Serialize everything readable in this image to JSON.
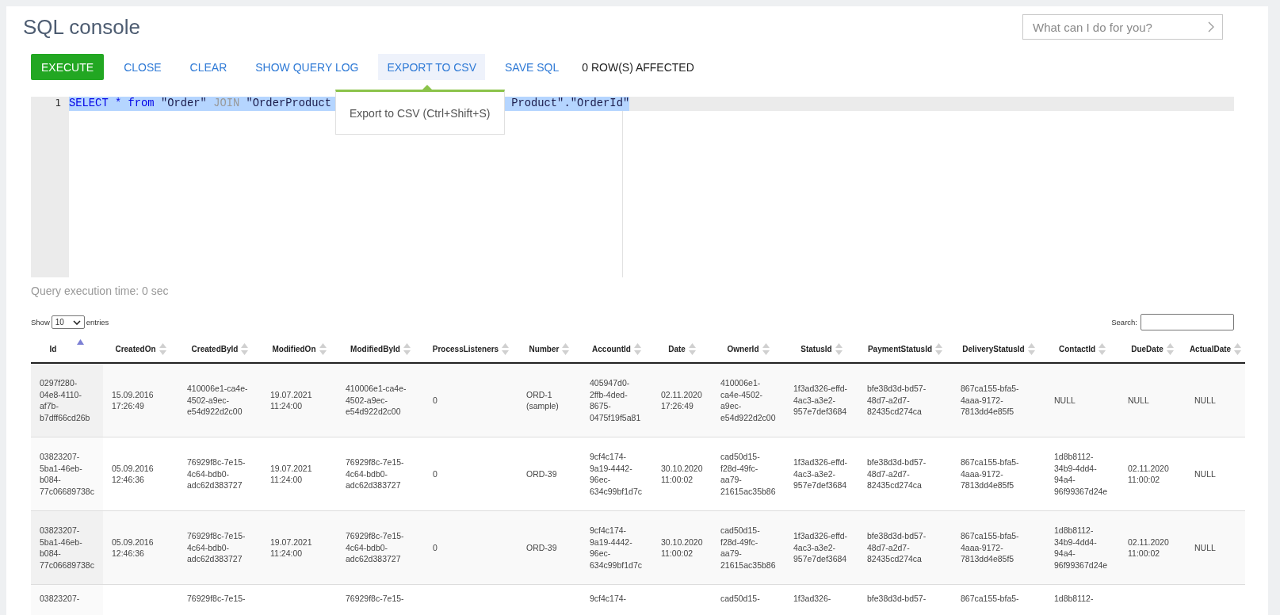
{
  "title": "SQL console",
  "assistant": {
    "placeholder": "What can I do for you?"
  },
  "toolbar": {
    "buttons": [
      {
        "label": "EXECUTE",
        "kind": "primary",
        "hovered": false
      },
      {
        "label": "CLOSE",
        "kind": "link",
        "hovered": false
      },
      {
        "label": "CLEAR",
        "kind": "link",
        "hovered": false
      },
      {
        "label": "SHOW QUERY LOG",
        "kind": "link",
        "hovered": false
      },
      {
        "label": "EXPORT TO CSV",
        "kind": "link",
        "hovered": true
      },
      {
        "label": "SAVE SQL",
        "kind": "link",
        "hovered": false
      }
    ],
    "status": "0 ROW(S) AFFECTED"
  },
  "editor": {
    "line_number": "1",
    "selected": true,
    "visible_parts": [
      [
        {
          "text": "SELECT",
          "kind": "keyword"
        },
        {
          "text": "*",
          "kind": "keyword"
        },
        {
          "text": "from",
          "kind": "keyword"
        },
        {
          "text": "\"Order\"",
          "kind": "string"
        },
        {
          "text": "JOIN",
          "kind": "muted"
        },
        {
          "text": "\"OrderProduct",
          "kind": "string"
        }
      ],
      [
        {
          "text": "Product\".\"OrderId\"",
          "kind": "string"
        }
      ]
    ]
  },
  "tooltip": {
    "text": "Export to CSV (Ctrl+Shift+S)"
  },
  "execution_time": "Query execution time: 0 sec",
  "table": {
    "show_label": "Show",
    "page_size": "10",
    "entries_label": "entries",
    "search_label": "Search:",
    "columns": [
      {
        "label": "Id",
        "sorted": true
      },
      {
        "label": "CreatedOn",
        "sorted": false
      },
      {
        "label": "CreatedById",
        "sorted": false
      },
      {
        "label": "ModifiedOn",
        "sorted": false
      },
      {
        "label": "ModifiedById",
        "sorted": false
      },
      {
        "label": "ProcessListeners",
        "sorted": false
      },
      {
        "label": "Number",
        "sorted": false
      },
      {
        "label": "AccountId",
        "sorted": false
      },
      {
        "label": "Date",
        "sorted": false
      },
      {
        "label": "OwnerId",
        "sorted": false
      },
      {
        "label": "StatusId",
        "sorted": false
      },
      {
        "label": "PaymentStatusId",
        "sorted": false
      },
      {
        "label": "DeliveryStatusId",
        "sorted": false
      },
      {
        "label": "ContactId",
        "sorted": false
      },
      {
        "label": "DueDate",
        "sorted": false
      },
      {
        "label": "ActualDate",
        "sorted": false
      }
    ],
    "rows": [
      {
        "cut": false,
        "cells": [
          "0297f280-04e8-4110-af7b-b7dff66cd26b",
          "15.09.2016 17:26:49",
          "410006e1-ca4e-4502-a9ec-e54d922d2c00",
          "19.07.2021 11:24:00",
          "410006e1-ca4e-4502-a9ec-e54d922d2c00",
          "0",
          "ORD-1 (sample)",
          "405947d0-2ffb-4ded-8675-0475f19f5a81",
          "02.11.2020 17:26:49",
          "410006e1-ca4e-4502-a9ec-e54d922d2c00",
          "1f3ad326-effd-4ac3-a3e2-957e7def3684",
          "bfe38d3d-bd57-48d7-a2d7-82435cd274ca",
          "867ca155-bfa5-4aaa-9172-7813dd4e85f5",
          "NULL",
          "NULL",
          "NULL"
        ]
      },
      {
        "cut": false,
        "cells": [
          "03823207-5ba1-46eb-b084-77c06689738c",
          "05.09.2016 12:46:36",
          "76929f8c-7e15-4c64-bdb0-adc62d383727",
          "19.07.2021 11:24:00",
          "76929f8c-7e15-4c64-bdb0-adc62d383727",
          "0",
          "ORD-39",
          "9cf4c174-9a19-4442-96ec-634c99bf1d7c",
          "30.10.2020 11:00:02",
          "cad50d15-f28d-49fc-aa79-21615ac35b86",
          "1f3ad326-effd-4ac3-a3e2-957e7def3684",
          "bfe38d3d-bd57-48d7-a2d7-82435cd274ca",
          "867ca155-bfa5-4aaa-9172-7813dd4e85f5",
          "1d8b8112-34b9-4dd4-94a4-96f99367d24e",
          "02.11.2020 11:00:02",
          "NULL"
        ]
      },
      {
        "cut": false,
        "cells": [
          "03823207-5ba1-46eb-b084-77c06689738c",
          "05.09.2016 12:46:36",
          "76929f8c-7e15-4c64-bdb0-adc62d383727",
          "19.07.2021 11:24:00",
          "76929f8c-7e15-4c64-bdb0-adc62d383727",
          "0",
          "ORD-39",
          "9cf4c174-9a19-4442-96ec-634c99bf1d7c",
          "30.10.2020 11:00:02",
          "cad50d15-f28d-49fc-aa79-21615ac35b86",
          "1f3ad326-effd-4ac3-a3e2-957e7def3684",
          "bfe38d3d-bd57-48d7-a2d7-82435cd274ca",
          "867ca155-bfa5-4aaa-9172-7813dd4e85f5",
          "1d8b8112-34b9-4dd4-94a4-96f99367d24e",
          "02.11.2020 11:00:02",
          "NULL"
        ]
      },
      {
        "cut": true,
        "cells": [
          "03823207-",
          null,
          "76929f8c-7e15-",
          null,
          "76929f8c-7e15-",
          null,
          null,
          "9cf4c174-",
          null,
          "cad50d15-",
          "1f3ad326-",
          "bfe38d3d-bd57-",
          "867ca155-bfa5-",
          "1d8b8112-",
          null,
          null
        ]
      }
    ]
  }
}
